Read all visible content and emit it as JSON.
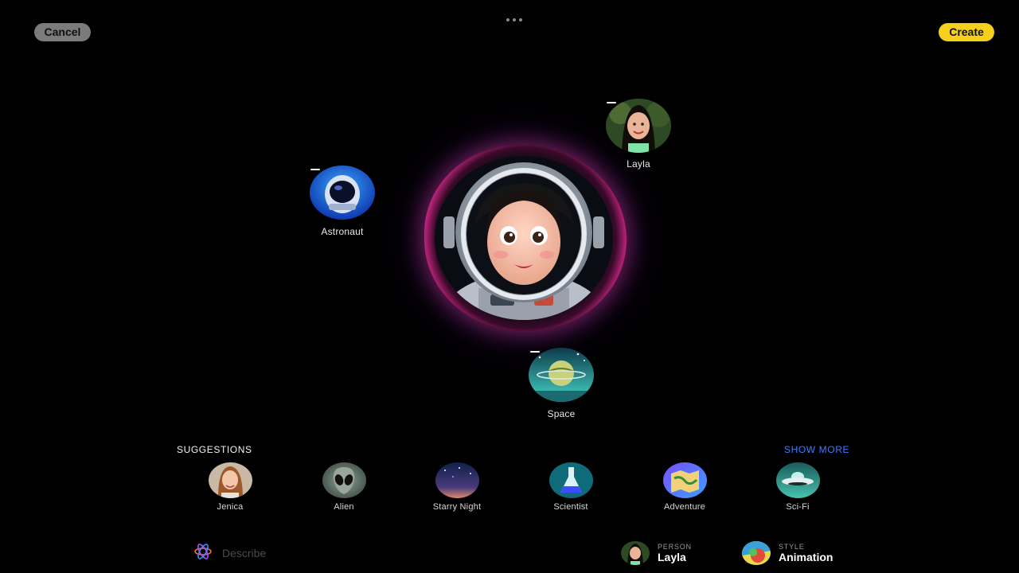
{
  "topbar": {
    "cancel": "Cancel",
    "create": "Create"
  },
  "bubbles": {
    "layla": {
      "label": "Layla",
      "icon": "person-photo"
    },
    "astronaut": {
      "label": "Astronaut",
      "icon": "astronaut-helmet"
    },
    "space": {
      "label": "Space",
      "icon": "planet"
    }
  },
  "suggestions": {
    "title": "SUGGESTIONS",
    "show_more": "SHOW MORE",
    "items": [
      {
        "label": "Jenica",
        "icon": "person-photo"
      },
      {
        "label": "Alien",
        "icon": "alien"
      },
      {
        "label": "Starry Night",
        "icon": "night-sky"
      },
      {
        "label": "Scientist",
        "icon": "flask"
      },
      {
        "label": "Adventure",
        "icon": "map"
      },
      {
        "label": "Sci-Fi",
        "icon": "ufo"
      }
    ]
  },
  "bottombar": {
    "describe_placeholder": "Describe",
    "person": {
      "caption": "PERSON",
      "value": "Layla"
    },
    "style": {
      "caption": "STYLE",
      "value": "Animation"
    }
  },
  "colors": {
    "accent_create": "#f6cf1c",
    "show_more": "#3d7bff",
    "glow": "#ff4fb0"
  }
}
